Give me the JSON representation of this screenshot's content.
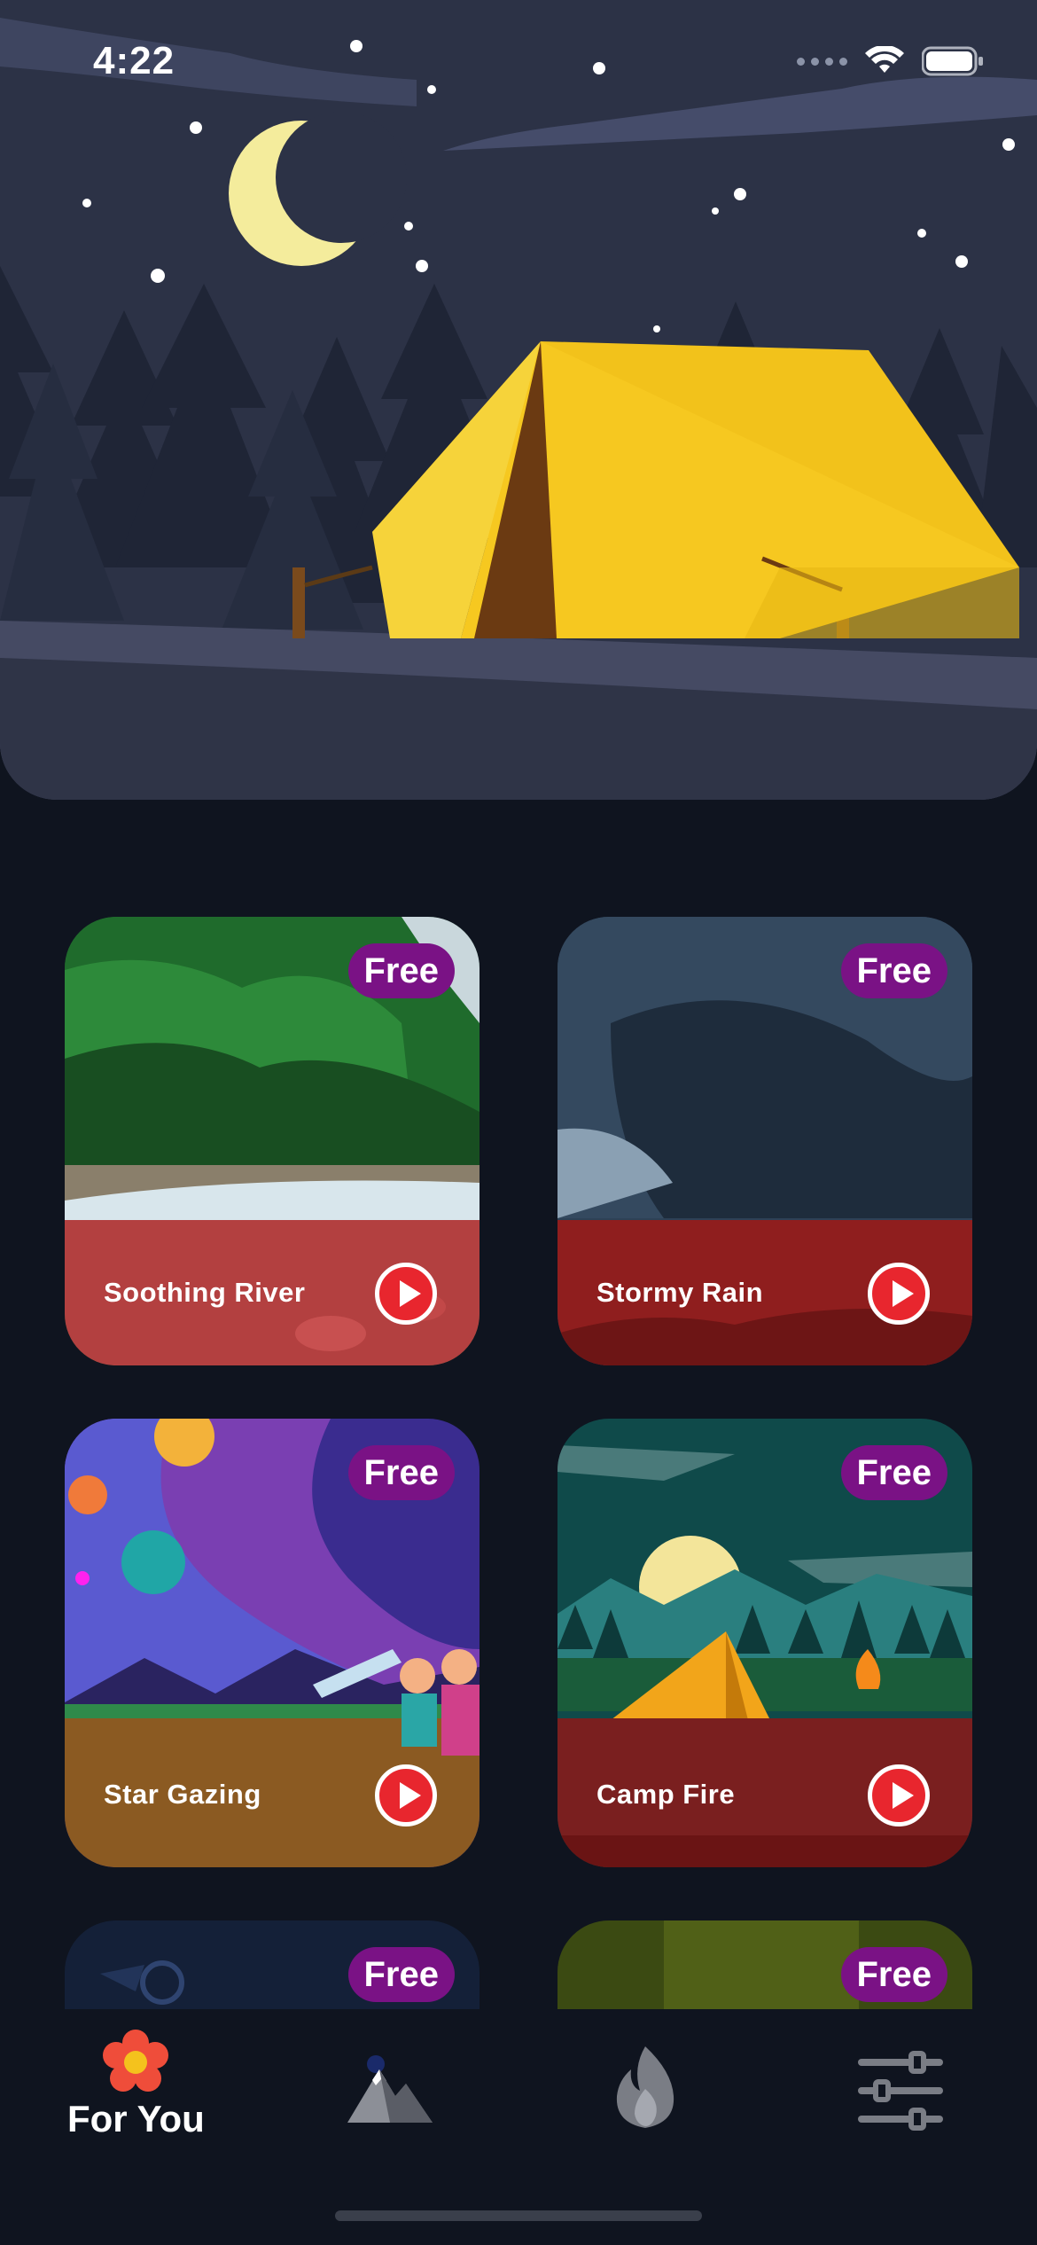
{
  "status_bar": {
    "time": "4:22"
  },
  "cards": [
    {
      "title": "Soothing River",
      "badge": "Free",
      "overlay_color": "#b23a3a"
    },
    {
      "title": "Stormy Rain",
      "badge": "Free",
      "overlay_color": "#9c1a1a"
    },
    {
      "title": "Star Gazing",
      "badge": "Free",
      "overlay_color": "#8a5a1e"
    },
    {
      "title": "Camp Fire",
      "badge": "Free",
      "overlay_color": "#7a1e1e"
    },
    {
      "title": "",
      "badge": "Free"
    },
    {
      "title": "",
      "badge": "Free"
    }
  ],
  "bottom_nav": {
    "items": [
      {
        "label": "For You",
        "icon": "flower-icon",
        "active": true
      },
      {
        "label": "",
        "icon": "mountain-icon",
        "active": false
      },
      {
        "label": "",
        "icon": "flame-icon",
        "active": false
      },
      {
        "label": "",
        "icon": "sliders-icon",
        "active": false
      }
    ]
  }
}
